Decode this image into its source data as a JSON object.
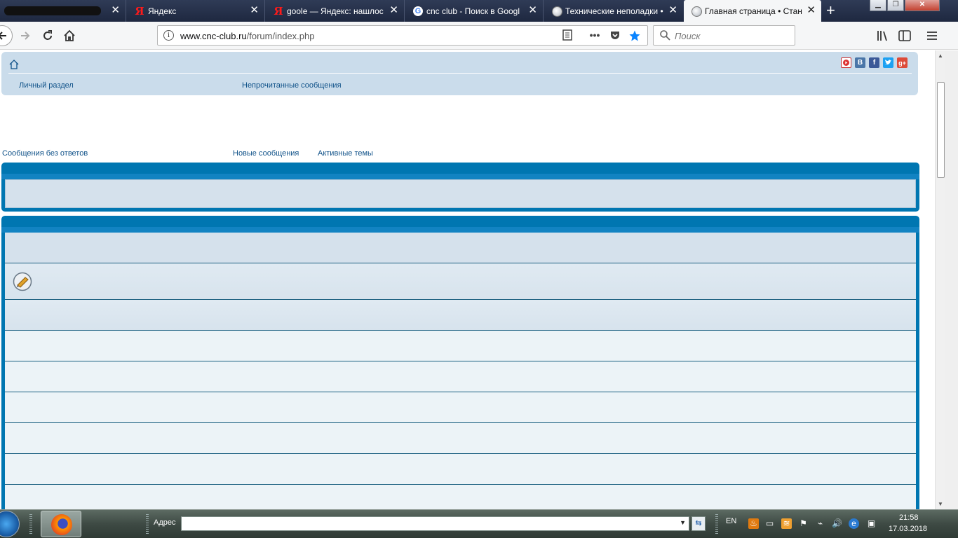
{
  "browser": {
    "tabs": [
      {
        "label": "",
        "icon": "redacted-tab-icon"
      },
      {
        "label": "Яндекс",
        "icon": "yandex-icon"
      },
      {
        "label": "goole — Яндекс: нашлос",
        "icon": "yandex-icon"
      },
      {
        "label": "cnc club - Поиск в Googl",
        "icon": "google-icon"
      },
      {
        "label": "Технические неполадки •",
        "icon": "cnc-club-icon"
      },
      {
        "label": "Главная страница • Стан",
        "icon": "cnc-club-icon",
        "active": true
      }
    ],
    "tab_close_glyph": "✕",
    "new_tab_glyph": "+",
    "url_host": "www.cnc-club.ru",
    "url_path": "/forum/index.php",
    "search_placeholder": "Поиск",
    "bookmark_star_color": "#0a84ff"
  },
  "forum": {
    "nav": {
      "personal": "Личный раздел",
      "unread": "Непрочитанные сообщения"
    },
    "search_links": {
      "unanswered": "Сообщения без ответов",
      "new_posts": "Новые сообщения",
      "active_topics": "Активные темы"
    },
    "social": [
      "youtube-icon",
      "vk-icon",
      "facebook-icon",
      "twitter-icon",
      "google-plus-icon"
    ],
    "colors": {
      "header_bg": "#cadceb",
      "forum_block": "#0076b1",
      "link": "#105289"
    }
  },
  "taskbar": {
    "address_label": "Адрес",
    "language": "EN",
    "time": "21:58",
    "date": "17.03.2018"
  }
}
